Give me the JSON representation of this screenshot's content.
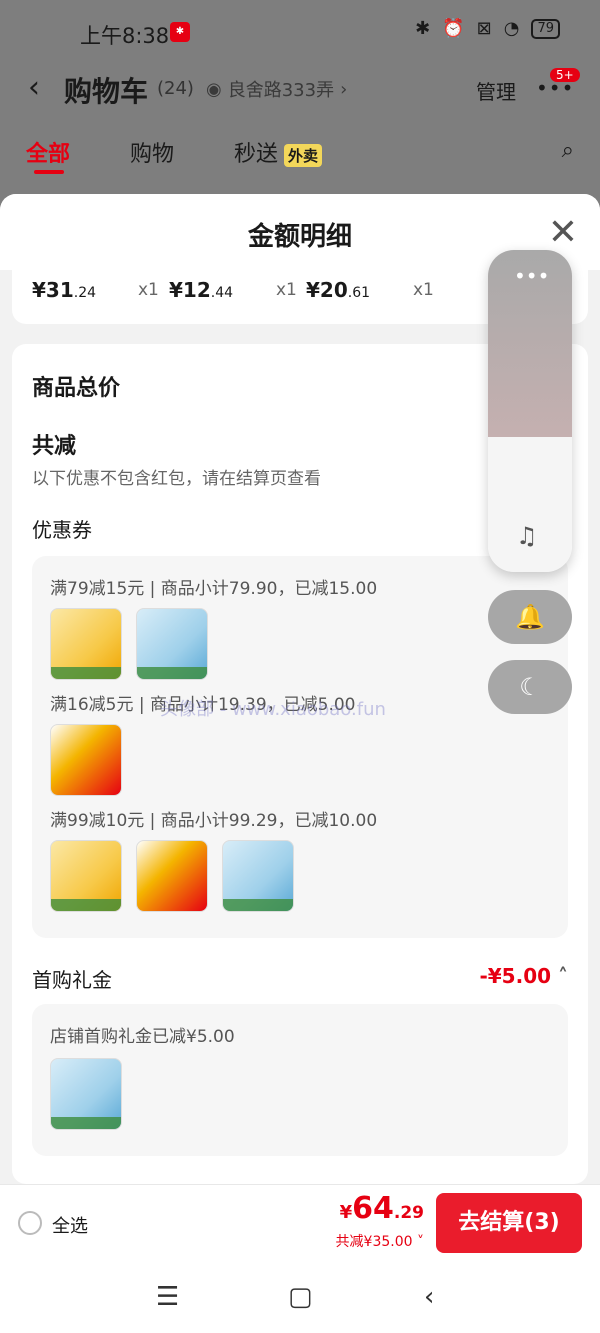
{
  "status_bar": {
    "time": "上午8:38",
    "battery": "79"
  },
  "header": {
    "back_icon": "chevron-left-icon",
    "title": "购物车",
    "count": "(24)",
    "address": "良舍路333弄",
    "manage": "管理",
    "more_badge": "5+"
  },
  "tabs": [
    {
      "label": "全部",
      "active": true
    },
    {
      "label": "购物",
      "active": false
    },
    {
      "label": "秒送",
      "active": false,
      "tag": "外卖"
    }
  ],
  "sheet": {
    "title": "金额明细",
    "prices": [
      {
        "price": "¥31",
        "cents": ".24",
        "qty": "x1"
      },
      {
        "price": "¥12",
        "cents": ".44",
        "qty": "x1"
      },
      {
        "price": "¥20",
        "cents": ".61",
        "qty": "x1"
      }
    ],
    "goods_total_label": "商品总价",
    "total_reduction_label": "共减",
    "note": "以下优惠不包含红包，请在结算页查看",
    "coupon_label": "优惠券",
    "coupons": [
      {
        "text": "满79减15元 | 商品小计79.90，已减15.00"
      },
      {
        "text": "满16减5元 | 商品小计19.39，已减5.00"
      },
      {
        "text": "满99减10元 | 商品小计99.29，已减10.00"
      }
    ],
    "gift_label": "首购礼金",
    "gift_amount": "-¥5.00",
    "gift_text": "店铺首购礼金已减¥5.00"
  },
  "bottom_bar": {
    "select_all": "全选",
    "currency": "¥",
    "total_int": "64",
    "total_cents": ".29",
    "total_reduction": "共减¥35.00",
    "checkout": "去结算(3)"
  },
  "watermark": "头像部 - www.xiaobao.fun"
}
